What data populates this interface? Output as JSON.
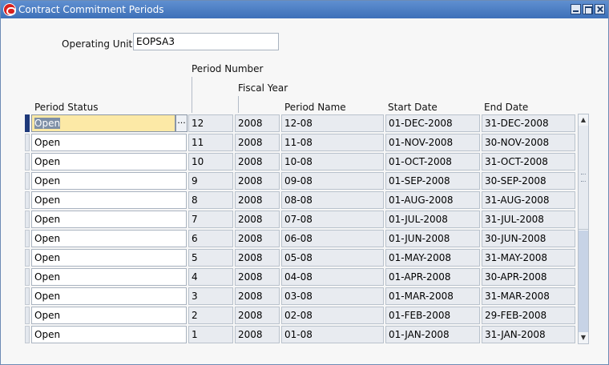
{
  "window": {
    "title": "Contract Commitment Periods"
  },
  "form": {
    "operating_unit_label": "Operating Unit",
    "operating_unit_value": "EOPSA3"
  },
  "columns": {
    "period_status": "Period Status",
    "period_number": "Period Number",
    "fiscal_year": "Fiscal Year",
    "period_name": "Period Name",
    "start_date": "Start Date",
    "end_date": "End Date"
  },
  "lov_button_label": "...",
  "scrollbar": {
    "up_arrow": "▲",
    "down_arrow": "▼"
  },
  "rows": [
    {
      "status": "Open",
      "number": "12",
      "year": "2008",
      "name": "12-08",
      "start": "01-DEC-2008",
      "end": "31-DEC-2008"
    },
    {
      "status": "Open",
      "number": "11",
      "year": "2008",
      "name": "11-08",
      "start": "01-NOV-2008",
      "end": "30-NOV-2008"
    },
    {
      "status": "Open",
      "number": "10",
      "year": "2008",
      "name": "10-08",
      "start": "01-OCT-2008",
      "end": "31-OCT-2008"
    },
    {
      "status": "Open",
      "number": "9",
      "year": "2008",
      "name": "09-08",
      "start": "01-SEP-2008",
      "end": "30-SEP-2008"
    },
    {
      "status": "Open",
      "number": "8",
      "year": "2008",
      "name": "08-08",
      "start": "01-AUG-2008",
      "end": "31-AUG-2008"
    },
    {
      "status": "Open",
      "number": "7",
      "year": "2008",
      "name": "07-08",
      "start": "01-JUL-2008",
      "end": "31-JUL-2008"
    },
    {
      "status": "Open",
      "number": "6",
      "year": "2008",
      "name": "06-08",
      "start": "01-JUN-2008",
      "end": "30-JUN-2008"
    },
    {
      "status": "Open",
      "number": "5",
      "year": "2008",
      "name": "05-08",
      "start": "01-MAY-2008",
      "end": "31-MAY-2008"
    },
    {
      "status": "Open",
      "number": "4",
      "year": "2008",
      "name": "04-08",
      "start": "01-APR-2008",
      "end": "30-APR-2008"
    },
    {
      "status": "Open",
      "number": "3",
      "year": "2008",
      "name": "03-08",
      "start": "01-MAR-2008",
      "end": "31-MAR-2008"
    },
    {
      "status": "Open",
      "number": "2",
      "year": "2008",
      "name": "02-08",
      "start": "01-FEB-2008",
      "end": "29-FEB-2008"
    },
    {
      "status": "Open",
      "number": "1",
      "year": "2008",
      "name": "01-08",
      "start": "01-JAN-2008",
      "end": "31-JAN-2008"
    }
  ]
}
